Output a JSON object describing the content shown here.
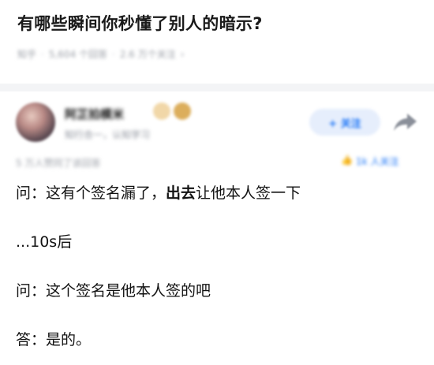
{
  "question": {
    "title": "有哪些瞬间你秒懂了别人的暗示?",
    "meta_topic": "知乎",
    "meta_followers": "5,604 个回答",
    "meta_views": "2.6 万个关注"
  },
  "author": {
    "name": "阿芷拍模米",
    "bio": "知行合一，认知学习",
    "follow_label": "+ 关注"
  },
  "vote": {
    "info": "5 万人赞同了该回答",
    "agree_label": "1k 人关注"
  },
  "answer": {
    "line1_prefix": "问：这有个签名漏了，",
    "line1_bold": "出去",
    "line1_suffix": "让他本人签一下",
    "line2": "...10s后",
    "line3": "问：这个签名是他本人签的吧",
    "line4": "答：是的。"
  },
  "colors": {
    "accent": "#1772f6",
    "divider": "#f3f4f6"
  }
}
